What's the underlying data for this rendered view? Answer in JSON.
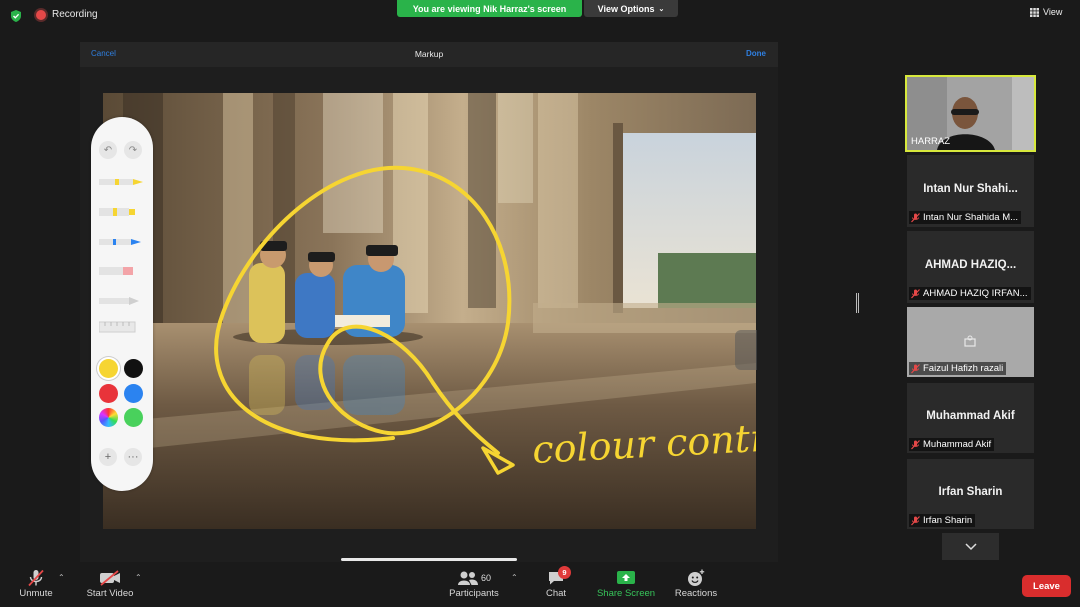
{
  "top_bar": {
    "recording_label": "Recording",
    "viewing_banner": "You are viewing Nik Harraz's screen",
    "view_options_label": "View Options",
    "view_label": "View"
  },
  "markup": {
    "cancel_label": "Cancel",
    "title": "Markup",
    "done_label": "Done",
    "annotation_text": "colour contrast",
    "colors": {
      "yellow": "#f6d532",
      "black": "#111111",
      "red": "#e8333a",
      "blue": "#2b83f0",
      "green": "#49d15c"
    }
  },
  "participants": {
    "speaker_name": "HARRAZ",
    "tiles": [
      {
        "display_name": "Intan Nur Shahi...",
        "label": "Intan Nur Shahida M..."
      },
      {
        "display_name": "AHMAD HAZIQ...",
        "label": "AHMAD HAZIQ IRFAN..."
      },
      {
        "display_name": "",
        "label": "Faizul Hafizh razali"
      },
      {
        "display_name": "Muhammad Akif",
        "label": "Muhammad Akif"
      },
      {
        "display_name": "Irfan Sharin",
        "label": "Irfan Sharin"
      }
    ]
  },
  "toolbar": {
    "unmute_label": "Unmute",
    "start_video_label": "Start Video",
    "participants_label": "Participants",
    "participants_count": "60",
    "chat_label": "Chat",
    "chat_badge": "9",
    "share_screen_label": "Share Screen",
    "reactions_label": "Reactions",
    "leave_label": "Leave",
    "accent_green": "#2ab34a",
    "leave_red": "#d92d2d"
  }
}
